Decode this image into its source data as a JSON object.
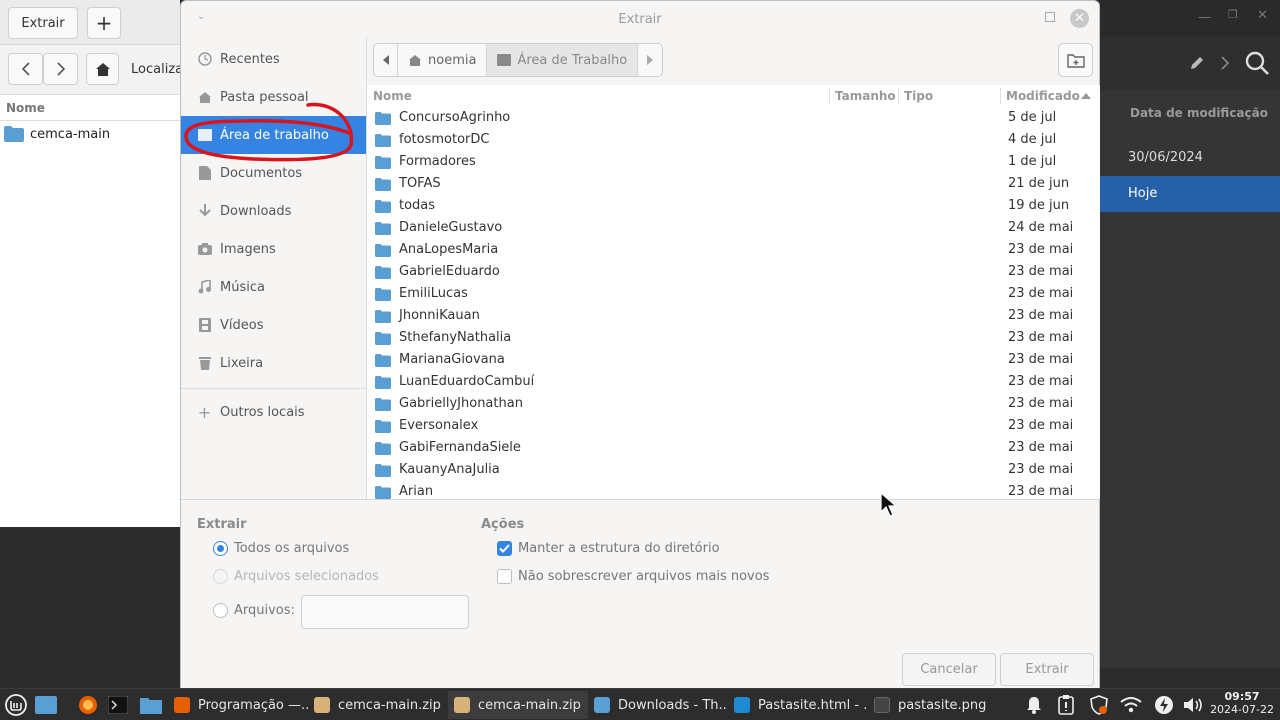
{
  "background_left": {
    "extract_button": "Extrair",
    "add_button": "+",
    "location_label": "Localiza",
    "column_name": "Nome",
    "item": "cemca-main"
  },
  "background_right": {
    "column_modified": "Data de modificação",
    "rows": [
      "30/06/2024",
      "Hoje"
    ]
  },
  "dialog": {
    "title": "Extrair",
    "sidebar": {
      "items": [
        {
          "label": "Recentes",
          "icon": "clock-icon"
        },
        {
          "label": "Pasta pessoal",
          "icon": "home-icon"
        },
        {
          "label": "Área de trabalho",
          "icon": "desktop-icon"
        },
        {
          "label": "Documentos",
          "icon": "document-icon"
        },
        {
          "label": "Downloads",
          "icon": "download-icon"
        },
        {
          "label": "Imagens",
          "icon": "camera-icon"
        },
        {
          "label": "Música",
          "icon": "music-icon"
        },
        {
          "label": "Vídeos",
          "icon": "film-icon"
        },
        {
          "label": "Lixeira",
          "icon": "trash-icon"
        }
      ],
      "other_locations": "Outros locais"
    },
    "pathbar": {
      "segments": [
        "noemia",
        "Área de Trabalho"
      ]
    },
    "columns": {
      "name": "Nome",
      "size": "Tamanho",
      "type": "Tipo",
      "modified": "Modificado"
    },
    "files": [
      {
        "name": "ConcursoAgrinho",
        "modified": "5 de jul"
      },
      {
        "name": "fotosmotorDC",
        "modified": "4 de jul"
      },
      {
        "name": "Formadores",
        "modified": "1 de jul"
      },
      {
        "name": "TOFAS",
        "modified": "21 de jun"
      },
      {
        "name": "todas",
        "modified": "19 de jun"
      },
      {
        "name": "DanieleGustavo",
        "modified": "24 de mai"
      },
      {
        "name": "AnaLopesMaria",
        "modified": "23 de mai"
      },
      {
        "name": "GabrielEduardo",
        "modified": "23 de mai"
      },
      {
        "name": "EmiliLucas",
        "modified": "23 de mai"
      },
      {
        "name": "JhonniKauan",
        "modified": "23 de mai"
      },
      {
        "name": "SthefanyNathalia",
        "modified": "23 de mai"
      },
      {
        "name": "MarianaGiovana",
        "modified": "23 de mai"
      },
      {
        "name": "LuanEduardoCambuí",
        "modified": "23 de mai"
      },
      {
        "name": "GabriellyJhonathan",
        "modified": "23 de mai"
      },
      {
        "name": "Eversonalex",
        "modified": "23 de mai"
      },
      {
        "name": "GabiFernandaSiele",
        "modified": "23 de mai"
      },
      {
        "name": "KauanyAnaJulia",
        "modified": "23 de mai"
      },
      {
        "name": "Arian",
        "modified": "23 de mai"
      }
    ],
    "extract_section": {
      "title": "Extrair",
      "all_files": "Todos os arquivos",
      "selected_files": "Arquivos selecionados",
      "files": "Arquivos:",
      "files_value": ""
    },
    "actions_section": {
      "title": "Ações",
      "keep_structure": "Manter a estrutura do diretório",
      "keep_structure_checked": true,
      "no_overwrite": "Não sobrescrever arquivos mais novos",
      "no_overwrite_checked": false
    },
    "cancel": "Cancelar",
    "extract": "Extrair"
  },
  "taskbar": {
    "tasks": [
      "Programação —...",
      "cemca-main.zip",
      "cemca-main.zip",
      "Downloads - Th...",
      "Pastasite.html - ...",
      "pastasite.png"
    ],
    "time": "09:57",
    "date": "2024-07-22"
  },
  "colors": {
    "accent": "#3584e4",
    "folder": "#5a9fd4",
    "annotation": "#d8141c",
    "selection_dark": "#2560a8"
  }
}
